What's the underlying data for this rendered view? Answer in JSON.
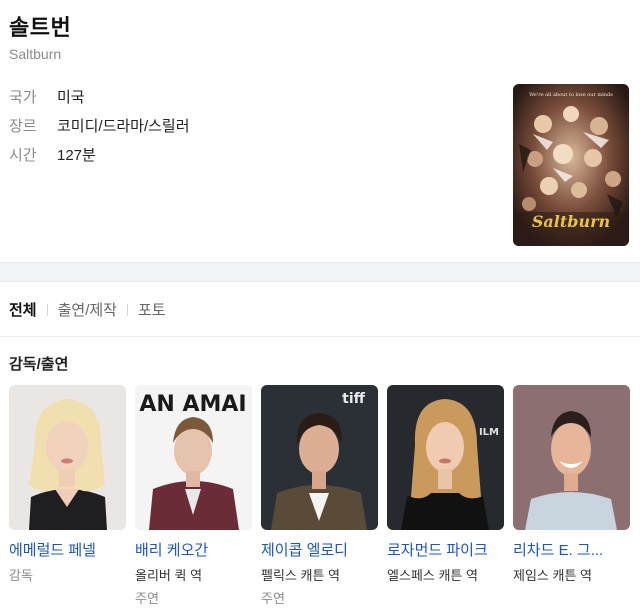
{
  "header": {
    "title": "솔트번",
    "subtitle": "Saltburn"
  },
  "info": [
    {
      "key": "국가",
      "value": "미국"
    },
    {
      "key": "장르",
      "value": "코미디/드라마/스릴러"
    },
    {
      "key": "시간",
      "value": "127분"
    }
  ],
  "poster": {
    "tagline": "We're all about to lose our minds",
    "title": "Saltburn"
  },
  "tabs": [
    {
      "label": "전체",
      "active": true
    },
    {
      "label": "출연/제작",
      "active": false
    },
    {
      "label": "포토",
      "active": false
    }
  ],
  "section_title": "감독/출연",
  "cast": [
    {
      "name": "에메럴드 페넬",
      "role": "감독",
      "role2": ""
    },
    {
      "name": "배리 케오간",
      "role": "올리버 퀵 역",
      "role2": "주연"
    },
    {
      "name": "제이콥 엘로디",
      "role": "펠릭스 캐튼 역",
      "role2": "주연"
    },
    {
      "name": "로자먼드 파이크",
      "role": "엘스페스 캐튼 역",
      "role2": ""
    },
    {
      "name": "리차드 E. 그...",
      "role": "제임스 캐튼 역",
      "role2": ""
    }
  ],
  "photo_backdrop_text": {
    "card2": "AN AMAI",
    "card3": "tiff",
    "card4": "AM ATI ILM"
  }
}
